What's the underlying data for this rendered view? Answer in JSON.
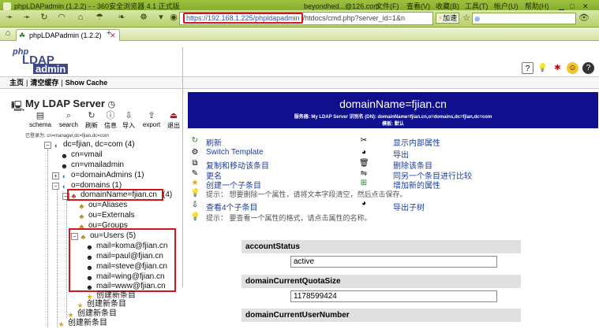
{
  "browser": {
    "window_title": "phpLDAPadmin (1.2.2) - - 360安全浏览器 4.1 正式版",
    "email": "beyondhed...@126.com",
    "menu": [
      "文件(F)",
      "查看(V)",
      "收藏(B)",
      "工具(T)",
      "帐户(U)",
      "帮助(H)"
    ],
    "url_highlight": "https://192.168.1.225/phpldapadmin",
    "url_rest": "/htdocs/cmd.php?server_id=1&n",
    "speed_label": "加速",
    "tab_label": "phpLDAPadmin (1.2.2)",
    "logo_text": [
      "php",
      "LDAP",
      "admin"
    ]
  },
  "topnav": {
    "home": "主页",
    "purge": "清空缓存",
    "show_cache": "Show Cache"
  },
  "server": {
    "title": "My LDAP Server",
    "tools": [
      "schema",
      "search",
      "刷新",
      "信息",
      "导入",
      "export",
      "退出"
    ],
    "logged_in": "已登录为: cn=manager,dc=fjian,dc=com"
  },
  "tree": {
    "root": "dc=fjian, dc=com (4)",
    "n1": "cn=vmail",
    "n2": "cn=vmailadmin",
    "n3": "o=domainAdmins (1)",
    "n4": "o=domains (1)",
    "n5": "domainName=fjian.cn",
    "n5_count": "(4)",
    "n6": "ou=Aliases",
    "n7": "ou=Externals",
    "n8": "ou=Groups",
    "n9": "ou=Users (5)",
    "mails": [
      "mail=koma@fjian.cn",
      "mail=paul@fjian.cn",
      "mail=steve@fjian.cn",
      "mail=wing@fjian.cn",
      "mail=www@fjian.cn"
    ],
    "create": "创建新条目"
  },
  "entry": {
    "title": "domainName=fjian.cn",
    "subtitle": "服务器: My LDAP Server    识别名 (DN): domainName=fjian.cn,o=domains,dc=fjian,dc=com",
    "template": "模板: 默认",
    "actions_left": [
      "刷新",
      "Switch Template",
      "复制和移动该条目",
      "更名",
      "创建一个子条目"
    ],
    "actions_right": [
      "显示内部属性",
      "导出",
      "删除该条目",
      "同另一个条目进行比较",
      "增加新的属性"
    ],
    "hint1": "提示：  想要删除一个属性，请将文本字段清空，然后点击保存。",
    "view_children": "查看4个子条目",
    "export_subtree": "导出子树",
    "hint2": "提示：  要查看一个属性的格式，请点击属性的名称。"
  },
  "attributes": [
    {
      "name": "accountStatus",
      "value": "active"
    },
    {
      "name": "domainCurrentQuotaSize",
      "value": "1178599424"
    },
    {
      "name": "domainCurrentUserNumber",
      "value": ""
    }
  ],
  "colors": {
    "header_bg": "#10108e",
    "highlight_box": "#d4161a",
    "chrome": "#9fc23e"
  }
}
